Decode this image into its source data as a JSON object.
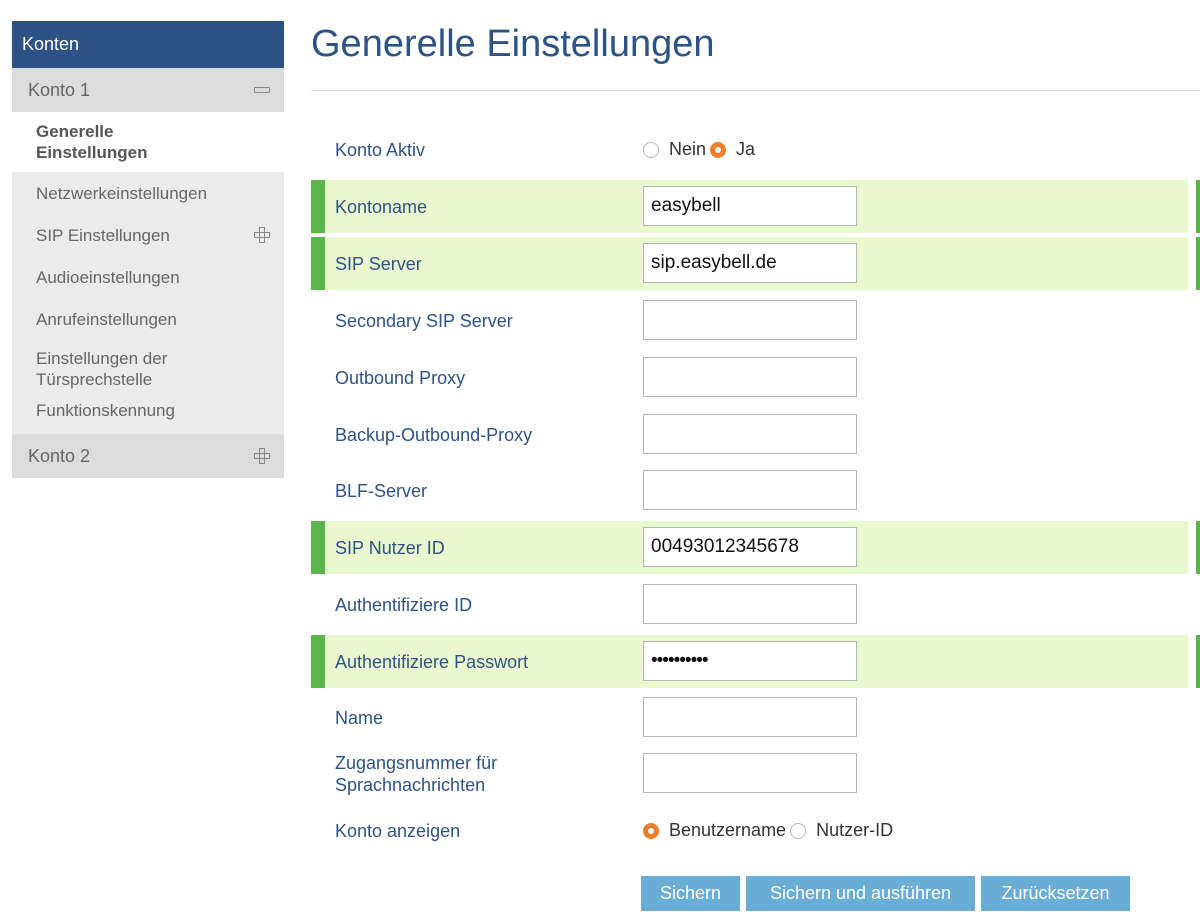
{
  "sidebar": {
    "header": "Konten",
    "groups": [
      {
        "label": "Konto 1"
      },
      {
        "label": "Konto 2"
      }
    ],
    "items": [
      {
        "label": "Generelle Einstellungen"
      },
      {
        "label": "Netzwerkeinstellungen"
      },
      {
        "label": "SIP Einstellungen"
      },
      {
        "label": "Audioeinstellungen"
      },
      {
        "label": "Anrufeinstellungen"
      },
      {
        "label": "Einstellungen der Türsprechstelle"
      },
      {
        "label": "Funktionskennung"
      }
    ]
  },
  "main": {
    "title": "Generelle Einstellungen",
    "konto_aktiv": {
      "label": "Konto Aktiv",
      "options": [
        "Nein",
        "Ja"
      ],
      "selected": "Ja"
    },
    "fields": [
      {
        "label": "Kontoname",
        "value": "easybell"
      },
      {
        "label": "SIP Server",
        "value": "sip.easybell.de"
      },
      {
        "label": "Secondary SIP Server",
        "value": ""
      },
      {
        "label": "Outbound Proxy",
        "value": ""
      },
      {
        "label": "Backup-Outbound-Proxy",
        "value": ""
      },
      {
        "label": "BLF-Server",
        "value": ""
      },
      {
        "label": "SIP Nutzer ID",
        "value": "00493012345678"
      },
      {
        "label": "Authentifiziere ID",
        "value": ""
      },
      {
        "label": "Authentifiziere Passwort",
        "value": "••••••••••"
      },
      {
        "label": "Name",
        "value": ""
      },
      {
        "label": "Zugangsnummer für Sprachnachrichten",
        "value": ""
      }
    ],
    "konto_anzeigen": {
      "label": "Konto anzeigen",
      "options": [
        "Benutzername",
        "Nutzer-ID"
      ],
      "selected": "Benutzername"
    },
    "buttons": {
      "save": "Sichern",
      "save_apply": "Sichern und ausführen",
      "reset": "Zurücksetzen"
    }
  },
  "colors": {
    "brand_blue": "#2d5286",
    "highlight_bg": "#eaf8cf",
    "highlight_bar": "#5cb54b",
    "radio_selected": "#f07d2a",
    "button_bg": "#6aaed6"
  }
}
